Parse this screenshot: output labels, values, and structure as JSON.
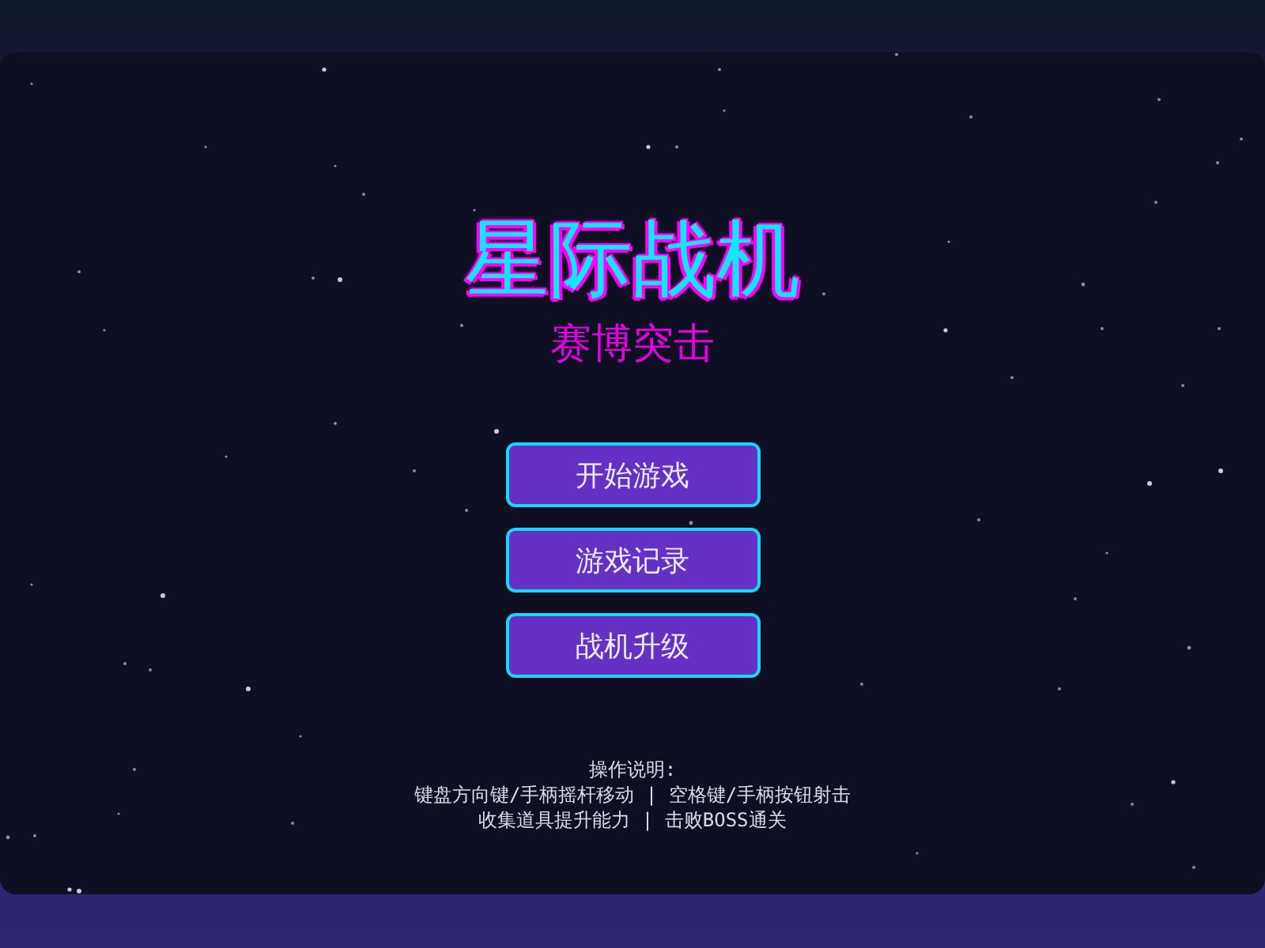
{
  "title": "星际战机",
  "subtitle": "赛博突击",
  "menu": [
    {
      "label": "开始游戏"
    },
    {
      "label": "游戏记录"
    },
    {
      "label": "战机升级"
    }
  ],
  "instructions": {
    "heading": "操作说明:",
    "lines": [
      "键盘方向键/手柄摇杆移动 | 空格键/手柄按钮射击",
      "收集道具提升能力 | 击败BOSS通关"
    ]
  }
}
